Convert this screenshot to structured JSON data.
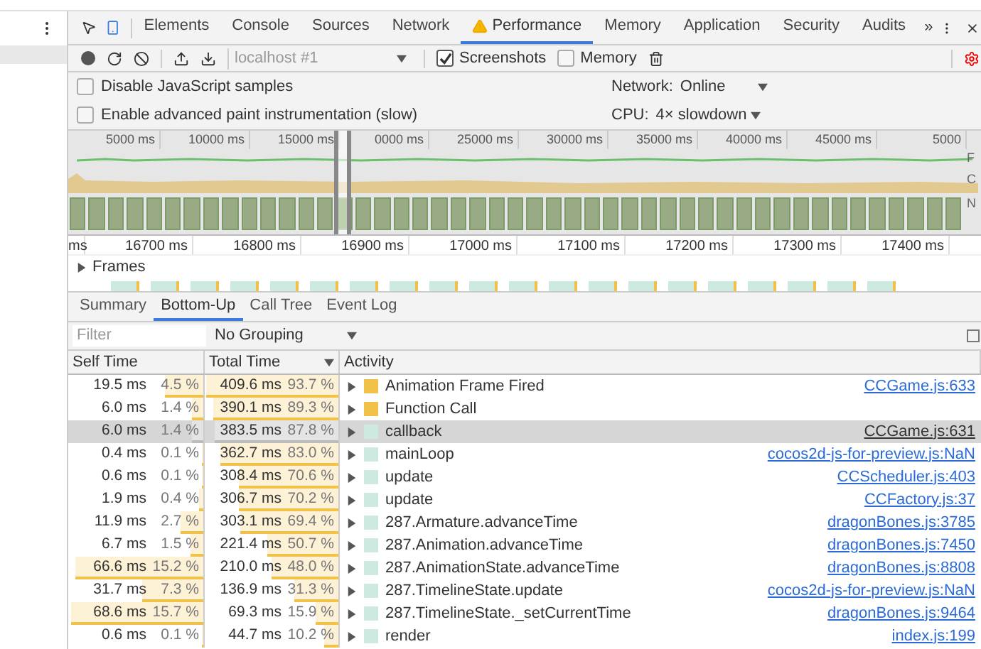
{
  "tabs": [
    {
      "label": "Elements",
      "selected": false,
      "warning": false
    },
    {
      "label": "Console",
      "selected": false,
      "warning": false
    },
    {
      "label": "Sources",
      "selected": false,
      "warning": false
    },
    {
      "label": "Network",
      "selected": false,
      "warning": false
    },
    {
      "label": "Performance",
      "selected": true,
      "warning": true
    },
    {
      "label": "Memory",
      "selected": false,
      "warning": false
    },
    {
      "label": "Application",
      "selected": false,
      "warning": false
    },
    {
      "label": "Security",
      "selected": false,
      "warning": false
    },
    {
      "label": "Audits",
      "selected": false,
      "warning": false
    }
  ],
  "more_tabs": "»",
  "toolbar": {
    "profile_select": "localhost #1",
    "screenshots": {
      "label": "Screenshots",
      "checked": true
    },
    "memory": {
      "label": "Memory",
      "checked": false
    }
  },
  "settings": {
    "options": [
      {
        "label": "Disable JavaScript samples",
        "checked": false
      },
      {
        "label": "Enable advanced paint instrumentation (slow)",
        "checked": false
      }
    ],
    "network_label": "Network:",
    "network_value": "Online",
    "cpu_label": "CPU:",
    "cpu_value": "4× slowdown"
  },
  "overview": {
    "ticks": [
      "5000 ms",
      "10000 ms",
      "15000 ms",
      "0000 ms",
      "25000 ms",
      "30000 ms",
      "35000 ms",
      "40000 ms",
      "45000 ms",
      "5000"
    ],
    "track_labels": [
      "F",
      "C",
      "N"
    ]
  },
  "detail": {
    "ticks": [
      "ms",
      "16700 ms",
      "16800 ms",
      "16900 ms",
      "17000 ms",
      "17100 ms",
      "17200 ms",
      "17300 ms",
      "17400 ms"
    ],
    "frames_label": "Frames"
  },
  "bottom_tabs": [
    {
      "label": "Summary",
      "selected": false
    },
    {
      "label": "Bottom-Up",
      "selected": true
    },
    {
      "label": "Call Tree",
      "selected": false
    },
    {
      "label": "Event Log",
      "selected": false
    }
  ],
  "filter": {
    "placeholder": "Filter"
  },
  "grouping": "No Grouping",
  "table": {
    "columns": [
      "Self Time",
      "Total Time",
      "Activity"
    ],
    "rows": [
      {
        "self": {
          "time": "19.5 ms",
          "pct": "4.5 %",
          "level": 0.29
        },
        "total": {
          "time": "409.6 ms",
          "pct": "93.7 %",
          "level": 1
        },
        "activity": "Animation Frame Fired",
        "color": "#f0c24a",
        "source": "CCGame.js:633",
        "selected": false
      },
      {
        "self": {
          "time": "6.0 ms",
          "pct": "1.4 %",
          "level": 0.09
        },
        "total": {
          "time": "390.1 ms",
          "pct": "89.3 %",
          "level": 0.95
        },
        "activity": "Function Call",
        "color": "#f0c24a",
        "selected": false
      },
      {
        "self": {
          "time": "6.0 ms",
          "pct": "1.4 %",
          "level": 0.09
        },
        "total": {
          "time": "383.5 ms",
          "pct": "87.8 %",
          "level": 0.94
        },
        "activity": "callback",
        "color": "#cdeadf",
        "source": "CCGame.js:631",
        "selected": true
      },
      {
        "self": {
          "time": "0.4 ms",
          "pct": "0.1 %",
          "level": 0.01
        },
        "total": {
          "time": "362.7 ms",
          "pct": "83.0 %",
          "level": 0.89
        },
        "activity": "mainLoop",
        "color": "#cdeadf",
        "source": "cocos2d-js-for-preview.js:NaN",
        "selected": false
      },
      {
        "self": {
          "time": "0.6 ms",
          "pct": "0.1 %",
          "level": 0.01
        },
        "total": {
          "time": "308.4 ms",
          "pct": "70.6 %",
          "level": 0.75
        },
        "activity": "update",
        "color": "#cdeadf",
        "source": "CCScheduler.js:403",
        "selected": false
      },
      {
        "self": {
          "time": "1.9 ms",
          "pct": "0.4 %",
          "level": 0.03
        },
        "total": {
          "time": "306.7 ms",
          "pct": "70.2 %",
          "level": 0.75
        },
        "activity": "update",
        "color": "#cdeadf",
        "source": "CCFactory.js:37",
        "selected": false
      },
      {
        "self": {
          "time": "11.9 ms",
          "pct": "2.7 %",
          "level": 0.17
        },
        "total": {
          "time": "303.1 ms",
          "pct": "69.4 %",
          "level": 0.74
        },
        "activity": "287.Armature.advanceTime",
        "color": "#cdeadf",
        "source": "dragonBones.js:3785",
        "selected": false
      },
      {
        "self": {
          "time": "6.7 ms",
          "pct": "1.5 %",
          "level": 0.1
        },
        "total": {
          "time": "221.4 ms",
          "pct": "50.7 %",
          "level": 0.54
        },
        "activity": "287.Animation.advanceTime",
        "color": "#cdeadf",
        "source": "dragonBones.js:7450",
        "selected": false
      },
      {
        "self": {
          "time": "66.6 ms",
          "pct": "15.2 %",
          "level": 0.97
        },
        "total": {
          "time": "210.0 ms",
          "pct": "48.0 %",
          "level": 0.51
        },
        "activity": "287.AnimationState.advanceTime",
        "color": "#cdeadf",
        "source": "dragonBones.js:8808",
        "selected": false
      },
      {
        "self": {
          "time": "31.7 ms",
          "pct": "7.3 %",
          "level": 0.46
        },
        "total": {
          "time": "136.9 ms",
          "pct": "31.3 %",
          "level": 0.33
        },
        "activity": "287.TimelineState.update",
        "color": "#cdeadf",
        "source": "cocos2d-js-for-preview.js:NaN",
        "selected": false
      },
      {
        "self": {
          "time": "68.6 ms",
          "pct": "15.7 %",
          "level": 1
        },
        "total": {
          "time": "69.3 ms",
          "pct": "15.9 %",
          "level": 0.17
        },
        "activity": "287.TimelineState._setCurrentTime",
        "color": "#cdeadf",
        "source": "dragonBones.js:9464",
        "selected": false
      },
      {
        "self": {
          "time": "0.6 ms",
          "pct": "0.1 %",
          "level": 0.01
        },
        "total": {
          "time": "44.7 ms",
          "pct": "10.2 %",
          "level": 0.11
        },
        "activity": "render",
        "color": "#cdeadf",
        "source": "index.js:199",
        "selected": false
      }
    ]
  }
}
